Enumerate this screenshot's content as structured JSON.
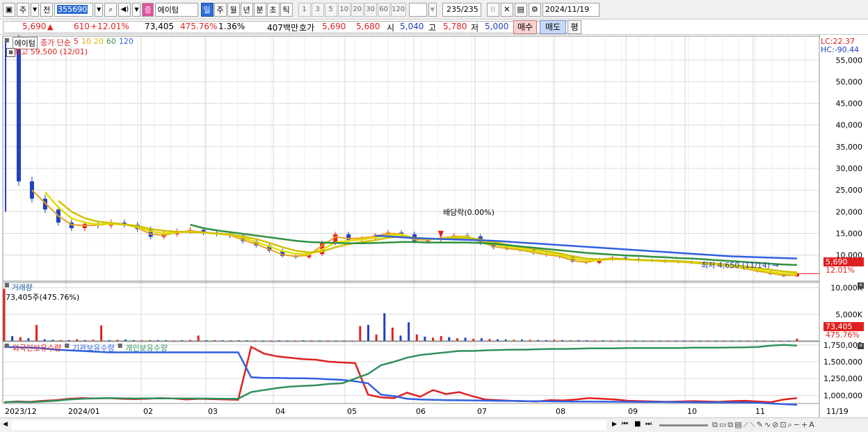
{
  "toolbar": {
    "period_button": "주",
    "prev_label": "전",
    "code": "355690",
    "name_badge": "증",
    "name": "에이텀",
    "tabs": [
      "일",
      "주",
      "월",
      "년",
      "분",
      "초",
      "틱"
    ],
    "numbers": [
      "1",
      "3",
      "5",
      "10",
      "20",
      "30",
      "60",
      "120"
    ],
    "count": "235",
    "count_total": "/235",
    "date": "2024/11/19"
  },
  "quote": {
    "price": "5,690",
    "change": "610",
    "change_pct": "+12.01%",
    "volume": "73,405",
    "volume_pct": "475.76%",
    "turnover": "1.36%",
    "amount": "407백만",
    "hoga_label": "호가",
    "ask": "5,690",
    "bid": "5,680",
    "open_label": "시",
    "open": "5,040",
    "high_label": "고",
    "high": "5,780",
    "low_label": "저",
    "low": "5,000",
    "buy_btn": "매수",
    "sell_btn": "매도",
    "eval_btn": "평"
  },
  "colors": {
    "up": "#e02020",
    "down": "#2040c0",
    "ma5": "#e8a020",
    "ma10": "#d0c000",
    "ma20": "#e0e000",
    "ma60": "#309040",
    "ma120": "#3060e0",
    "foreign": "#e02020",
    "institution": "#3060e0",
    "individual": "#309060"
  },
  "price_panel": {
    "legend_name": "에이텀",
    "legend_type": "종가 단순",
    "ma_periods": [
      "5",
      "10",
      "20",
      "60",
      "120"
    ],
    "high_note": "최고 59,500 (12/01)",
    "low_note": "최저 4,650 (11/14) →",
    "dividend_note": "배당락(0.00%)",
    "lc": "LC:22.37",
    "hc": "HC:-90.44",
    "last_price": "5,690",
    "last_pct": "12.01%"
  },
  "volume_panel": {
    "title": "거래량",
    "value": "73,405주(475.76%)",
    "last": "73,405",
    "last_pct": "475.76%"
  },
  "holdings_panel": {
    "legend": [
      "외국인보유수량",
      "기관보유수량",
      "개인보유수량"
    ]
  },
  "x_axis_labels": [
    "2023/12",
    "2024/01",
    "02",
    "03",
    "04",
    "05",
    "06",
    "07",
    "08",
    "09",
    "10",
    "11",
    "11/19"
  ],
  "chart_data": [
    {
      "type": "line",
      "title": "에이텀 종가 단순",
      "y_ticks": [
        10000,
        15000,
        20000,
        25000,
        30000,
        35000,
        40000,
        45000,
        50000,
        55000
      ],
      "y_tick_labels": [
        "10,000",
        "15,000",
        "20,000",
        "25,000",
        "30,000",
        "35,000",
        "40,000",
        "45,000",
        "50,000",
        "55,000"
      ],
      "ylim": [
        4000,
        60500
      ],
      "x_months": [
        "2023/12",
        "2024/01",
        "02",
        "03",
        "04",
        "05",
        "06",
        "07",
        "08",
        "09",
        "10",
        "11"
      ],
      "series": [
        {
          "name": "종가",
          "values": [
            59500,
            27000,
            23000,
            20500,
            17500,
            16200,
            17200,
            16800,
            17500,
            17000,
            16000,
            14200,
            14800,
            15500,
            15800,
            15200,
            14900,
            14500,
            13200,
            12200,
            11000,
            9800,
            9500,
            10200,
            12800,
            14800,
            13500,
            13800,
            14500,
            15200,
            14800,
            13200,
            13500,
            14000,
            14500,
            14300,
            12800,
            11800,
            11500,
            11200,
            10500,
            10000,
            9600,
            8500,
            8200,
            9000,
            9400,
            9100,
            8800,
            8700,
            8500,
            8400,
            8200,
            7900,
            7700,
            7200,
            6800,
            6200,
            5600,
            5100,
            5690
          ]
        },
        {
          "name": "5",
          "values": [
            null,
            null,
            25000,
            22000,
            19000,
            17000,
            16800,
            16900,
            17200,
            17100,
            16300,
            14800,
            14600,
            15200,
            15600,
            15300,
            14900,
            14600,
            13500,
            12500,
            11300,
            10100,
            9700,
            10000,
            12200,
            14200,
            13800,
            13900,
            14300,
            15000,
            14900,
            13500,
            13500,
            13900,
            14300,
            14300,
            13000,
            12000,
            11500,
            11200,
            10600,
            10100,
            9700,
            8700,
            8300,
            8900,
            9300,
            9100,
            8800,
            8700,
            8500,
            8400,
            8200,
            7900,
            7700,
            7300,
            6900,
            6300,
            5800,
            5300,
            5400
          ]
        },
        {
          "name": "10",
          "values": [
            null,
            null,
            null,
            24500,
            21000,
            18500,
            17500,
            17100,
            17200,
            17000,
            16500,
            15500,
            15000,
            15200,
            15400,
            15200,
            14900,
            14700,
            14000,
            13000,
            12000,
            10900,
            10300,
            10200,
            11300,
            12900,
            13300,
            13600,
            14000,
            14600,
            14700,
            13900,
            13600,
            13800,
            14100,
            14200,
            13400,
            12500,
            11900,
            11500,
            10900,
            10400,
            10000,
            9200,
            8700,
            8800,
            9100,
            9000,
            8800,
            8700,
            8600,
            8500,
            8300,
            8000,
            7800,
            7500,
            7100,
            6600,
            6100,
            5700,
            5600
          ]
        },
        {
          "name": "20",
          "values": [
            null,
            null,
            null,
            null,
            22500,
            20000,
            18500,
            17700,
            17400,
            17100,
            16700,
            16000,
            15600,
            15400,
            15300,
            15200,
            15000,
            14800,
            14300,
            13700,
            12800,
            11800,
            11000,
            10600,
            10800,
            11800,
            12500,
            13000,
            13400,
            14000,
            14300,
            14000,
            13800,
            13700,
            13900,
            14000,
            13600,
            13000,
            12400,
            11900,
            11400,
            10900,
            10400,
            9700,
            9200,
            9000,
            9100,
            9000,
            8900,
            8800,
            8700,
            8600,
            8400,
            8200,
            8000,
            7700,
            7400,
            7000,
            6600,
            6200,
            6000
          ]
        },
        {
          "name": "60",
          "values": [
            null,
            null,
            null,
            null,
            null,
            null,
            null,
            null,
            null,
            null,
            null,
            null,
            null,
            null,
            17000,
            16200,
            15700,
            15300,
            14900,
            14500,
            14100,
            13700,
            13300,
            13000,
            12900,
            12800,
            12700,
            12700,
            12800,
            12900,
            13000,
            13000,
            12900,
            12900,
            12900,
            12900,
            12800,
            12600,
            12300,
            12000,
            11700,
            11400,
            11100,
            10800,
            10500,
            10300,
            10100,
            9900,
            9800,
            9600,
            9500,
            9300,
            9200,
            9000,
            8800,
            8600,
            8400,
            8200,
            8000,
            7800,
            7700
          ]
        },
        {
          "name": "120",
          "values": [
            null,
            null,
            null,
            null,
            null,
            null,
            null,
            null,
            null,
            null,
            null,
            null,
            null,
            null,
            null,
            null,
            null,
            null,
            null,
            null,
            null,
            null,
            null,
            null,
            null,
            null,
            null,
            null,
            14500,
            14300,
            14100,
            13900,
            13800,
            13700,
            13600,
            13500,
            13400,
            13300,
            13100,
            12900,
            12700,
            12500,
            12300,
            12100,
            11900,
            11700,
            11500,
            11300,
            11100,
            10900,
            10700,
            10500,
            10300,
            10100,
            9900,
            9700,
            9600,
            9500,
            9400,
            9300,
            9200
          ]
        }
      ]
    },
    {
      "type": "bar",
      "title": "거래량",
      "y_ticks": [
        5000000,
        10000000
      ],
      "y_tick_labels": [
        "5,000K",
        "10,000K"
      ],
      "ylim": [
        0,
        11000000
      ],
      "values": [
        9800000,
        900000,
        700000,
        500000,
        3000000,
        300000,
        200000,
        150000,
        180000,
        300000,
        150000,
        200000,
        2900000,
        150000,
        200000,
        250000,
        150000,
        120000,
        150000,
        150000,
        120000,
        100000,
        130000,
        180000,
        1000000,
        120000,
        150000,
        120000,
        100000,
        120000,
        100000,
        80000,
        80000,
        90000,
        100000,
        80000,
        70000,
        120000,
        100000,
        80000,
        90000,
        70000,
        60000,
        70000,
        2800000,
        3000000,
        1200000,
        5200000,
        2500000,
        1000000,
        3500000,
        1200000,
        800000,
        600000,
        900000,
        700000,
        500000,
        600000,
        400000,
        500000,
        350000,
        300000,
        250000,
        200000,
        250000,
        200000,
        180000,
        150000,
        200000,
        150000,
        120000,
        150000,
        130000,
        100000,
        120000,
        100000,
        90000,
        80000,
        90000,
        70000,
        80000,
        70000,
        60000,
        70000,
        60000,
        50000,
        60000,
        50000,
        60000,
        50000,
        70000,
        60000,
        50000,
        60000,
        50000,
        40000,
        50000,
        60000,
        400000
      ],
      "up_flags": [
        1,
        0,
        1,
        0,
        1,
        0,
        0,
        1,
        0,
        1,
        0,
        1,
        1,
        0,
        1,
        0,
        0,
        1,
        1,
        0,
        0,
        1,
        0,
        1,
        1,
        0,
        1,
        0,
        1,
        0,
        0,
        1,
        0,
        1,
        0,
        0,
        1,
        0,
        1,
        0,
        1,
        0,
        0,
        1,
        1,
        0,
        1,
        0,
        1,
        0,
        0,
        1,
        0,
        1,
        1,
        0,
        1,
        0,
        1,
        0,
        1,
        0,
        0,
        1,
        0,
        1,
        0,
        0,
        1,
        0,
        1,
        0,
        0,
        1,
        0,
        1,
        0,
        1,
        0,
        0,
        1,
        0,
        1,
        0,
        0,
        1,
        0,
        1,
        0,
        1,
        0,
        0,
        1,
        0,
        1,
        0,
        1,
        0,
        1
      ]
    },
    {
      "type": "line",
      "title": "보유수량",
      "y_ticks": [
        1000000,
        1250000,
        1500000,
        1750000
      ],
      "y_tick_labels": [
        "1,000,000",
        "1,250,000",
        "1,500,000",
        "1,750,000"
      ],
      "ylim": [
        880000,
        1800000
      ],
      "series": [
        {
          "name": "외국인보유수량",
          "values": [
            900000,
            910000,
            905000,
            920000,
            930000,
            950000,
            960000,
            955000,
            960000,
            950000,
            945000,
            950000,
            960000,
            955000,
            940000,
            950000,
            945000,
            940000,
            935000,
            1720000,
            1620000,
            1580000,
            1560000,
            1540000,
            1530000,
            1500000,
            1490000,
            1480000,
            1010000,
            970000,
            960000,
            1040000,
            980000,
            1080000,
            1020000,
            1050000,
            990000,
            940000,
            930000,
            920000,
            915000,
            910000,
            930000,
            925000,
            940000,
            960000,
            950000,
            940000,
            920000,
            915000,
            910000,
            905000,
            910000,
            915000,
            910000,
            905000,
            915000,
            920000,
            910000,
            900000,
            940000,
            960000
          ]
        },
        {
          "name": "기관보유수량",
          "values": [
            1720000,
            1715000,
            1710000,
            1700000,
            1680000,
            1670000,
            1660000,
            1650000,
            1640000,
            1640000,
            1640000,
            1640000,
            1640000,
            1640000,
            1640000,
            1640000,
            1640000,
            1640000,
            1640000,
            1270000,
            1260000,
            1260000,
            1255000,
            1255000,
            1250000,
            1240000,
            1230000,
            1210000,
            1180000,
            1010000,
            990000,
            950000,
            940000,
            935000,
            930000,
            928000,
            925000,
            922000,
            920000,
            918000,
            915000,
            913000,
            912000,
            910000,
            909000,
            908000,
            907000,
            906000,
            905000,
            904000,
            903000,
            902000,
            901000,
            900000,
            899000,
            898000,
            897000,
            896000,
            890000,
            880000,
            870000,
            860000
          ]
        },
        {
          "name": "개인보유수량",
          "values": [
            900000,
            905000,
            900000,
            910000,
            920000,
            940000,
            950000,
            955000,
            960000,
            958000,
            955000,
            956000,
            955000,
            955000,
            954000,
            953000,
            952000,
            950000,
            950000,
            1050000,
            1080000,
            1110000,
            1130000,
            1140000,
            1150000,
            1170000,
            1180000,
            1250000,
            1320000,
            1450000,
            1500000,
            1560000,
            1600000,
            1620000,
            1640000,
            1660000,
            1660000,
            1670000,
            1675000,
            1680000,
            1680000,
            1685000,
            1690000,
            1690000,
            1695000,
            1700000,
            1700000,
            1700000,
            1705000,
            1705000,
            1705000,
            1705000,
            1705000,
            1710000,
            1710000,
            1710000,
            1712000,
            1715000,
            1720000,
            1740000,
            1750000,
            1740000
          ]
        }
      ]
    }
  ]
}
